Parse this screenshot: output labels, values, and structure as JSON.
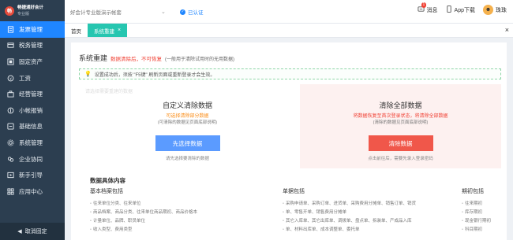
{
  "brand": {
    "name": "畅捷通好会计",
    "version": "专业版"
  },
  "sidebar": {
    "items": [
      {
        "label": "发票管理",
        "icon": "invoice-icon",
        "active": true
      },
      {
        "label": "税务管理",
        "icon": "tax-icon",
        "active": false
      },
      {
        "label": "固定资产",
        "icon": "asset-icon",
        "active": false
      },
      {
        "label": "工资",
        "icon": "salary-icon",
        "active": false
      },
      {
        "label": "经营管理",
        "icon": "business-icon",
        "active": false
      },
      {
        "label": "小帐报销",
        "icon": "reimburse-icon",
        "active": false
      },
      {
        "label": "基础信息",
        "icon": "basic-info-icon",
        "active": false
      },
      {
        "label": "系统管理",
        "icon": "system-icon",
        "active": false
      },
      {
        "label": "企业协同",
        "icon": "collaborate-icon",
        "active": false
      },
      {
        "label": "新手引导",
        "icon": "guide-icon",
        "active": false
      },
      {
        "label": "应用中心",
        "icon": "app-center-icon",
        "active": false
      }
    ],
    "collapse_label": "取消固定"
  },
  "topbar": {
    "search_placeholder": "好会计专业版演示帐套",
    "auth_label": "已认证",
    "messages_label": "消息",
    "messages_count": "1",
    "app_download_label": "App下载",
    "username": "珠珠"
  },
  "tabs": {
    "home_label": "首页",
    "active_label": "系统重建"
  },
  "page": {
    "title": "系统重建",
    "warning_red": "数据清除后，不可恢复",
    "warning_grey": "(一般用于清除试用时的无用数据)",
    "notice": "设置成功后，须按 \"F5键\" 刷新页面或重新登录才会生效。",
    "ghost_title": "请选择需要重建的数据",
    "custom": {
      "title": "自定义清除数据",
      "line1": "可选择清除部分数据",
      "line2": "(可清除的数据见页面底部说明)",
      "button": "先选择数据",
      "hint": "请先选择要清除的数据"
    },
    "all": {
      "title": "清除全部数据",
      "line1": "将数据恢复至首次登录状态，将清除全部数据",
      "line2": "(清除的数据见页面底部说明)",
      "button": "清除数据",
      "hint": "点击前往后，需要先录入登录密码"
    }
  },
  "details": {
    "title": "数据具体内容",
    "col1": {
      "title": "基本档案包括",
      "lines": [
        "往来单位分类、往来单位",
        "商品档案、商品分类、往来单位商品期初、商品价格本",
        "计量单位、品牌、职员单位",
        "收入类型、费用类型"
      ]
    },
    "col2": {
      "title": "单据包括",
      "lines": [
        "采购申请单、采购订单、进货单、采购费用分摊单、销售订单、销货",
        "单、零售开单、销售费用分摊单",
        "其它入库单、其它出库单、调拨单、盘点单、拆装单、产成品入库",
        "单、材料出库单、成本调整单、委托单"
      ]
    },
    "col3": {
      "title": "期初包括",
      "lines": [
        "往来期初",
        "库存期初",
        "现金银行期初",
        "科目期初"
      ]
    }
  }
}
